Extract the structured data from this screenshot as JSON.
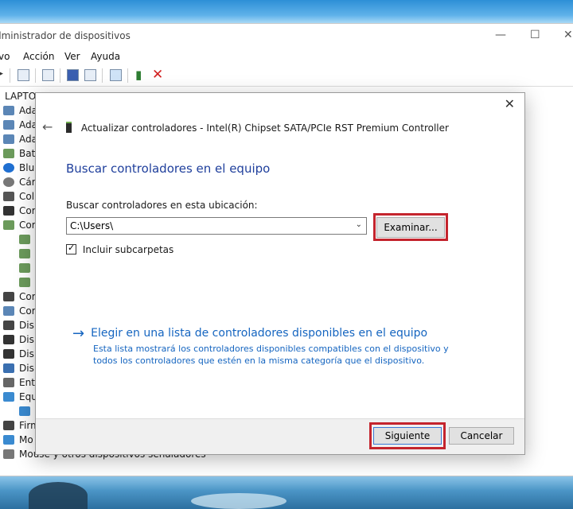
{
  "device_manager": {
    "title": "dministrador de dispositivos",
    "menu": [
      "vo",
      "Acción",
      "Ver",
      "Ayuda"
    ],
    "tree_root": "LAPTO",
    "tree_items": [
      "Ada",
      "Ada",
      "Ada",
      "Bat",
      "Blu",
      "Cár",
      "Col",
      "Cor",
      "Cor",
      "Cor",
      "Cor",
      "Dis",
      "Dis",
      "Dis",
      "Dis",
      "Ent",
      "Equ",
      "Firm",
      "Mo"
    ],
    "bottom_item": "Mouse y otros dispositivos señaladores"
  },
  "dialog": {
    "header": "Actualizar controladores - Intel(R) Chipset SATA/PCIe RST Premium Controller",
    "heading": "Buscar controladores en el equipo",
    "search_label": "Buscar controladores en esta ubicación:",
    "path_value": "C:\\Users\\",
    "browse_label": "Examinar...",
    "include_subfolders": "Incluir subcarpetas",
    "link_title": "Elegir en una lista de controladores disponibles en el equipo",
    "link_description": "Esta lista mostrará los controladores disponibles compatibles con el dispositivo y todos los controladores que estén en la misma categoría que el dispositivo.",
    "next_label": "Siguiente",
    "cancel_label": "Cancelar"
  },
  "icons": {
    "close": "close-icon",
    "back": "back-arrow-icon",
    "link_arrow": "arrow-right-icon"
  },
  "colors": {
    "heading_blue": "#1f3f9c",
    "link_blue": "#1565c0",
    "highlight_red": "#c4242d"
  }
}
